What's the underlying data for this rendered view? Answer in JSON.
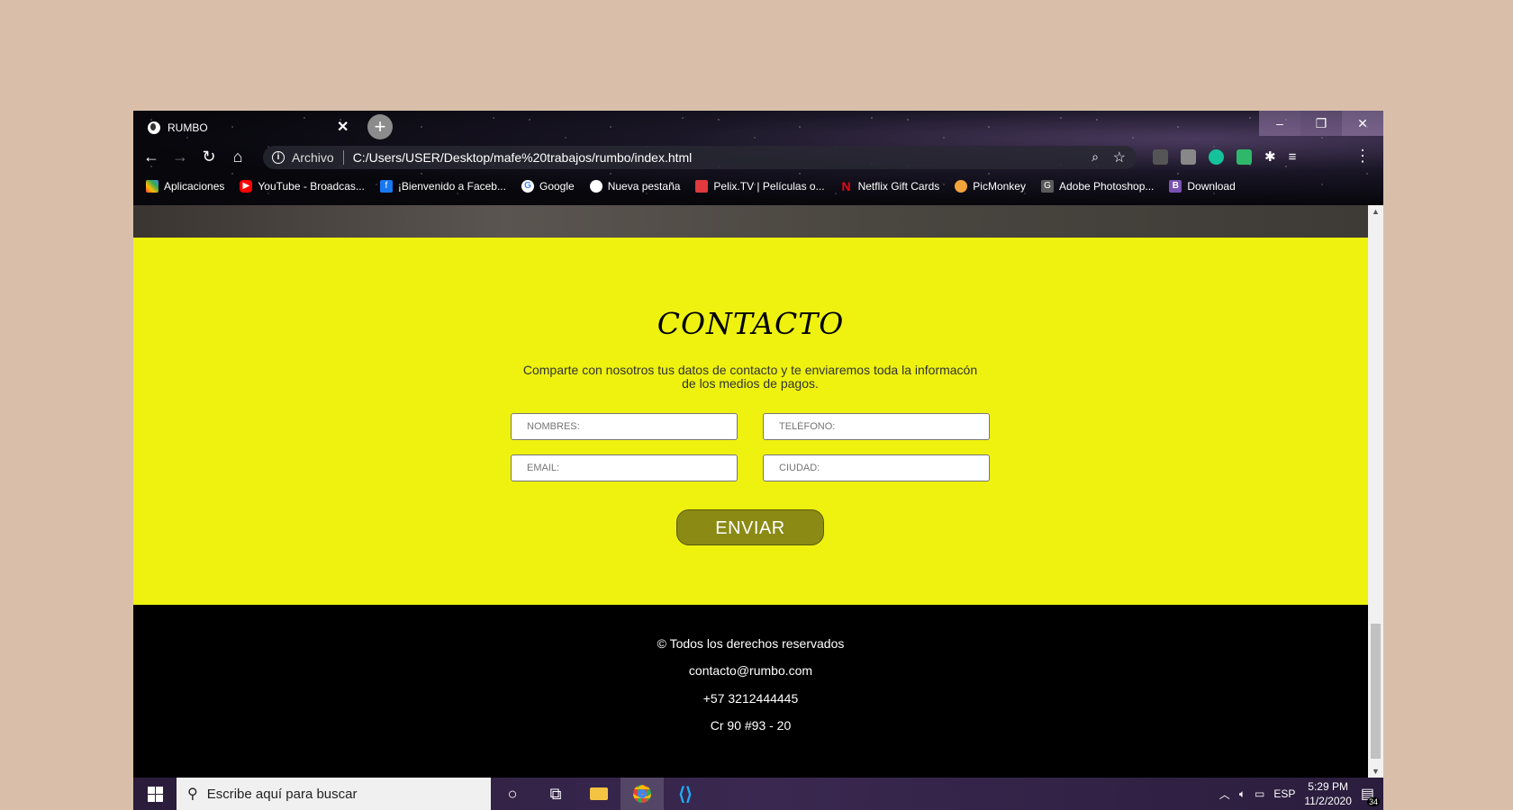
{
  "browser": {
    "tab_title": "RUMBO",
    "tab_close": "✕",
    "new_tab": "+",
    "security_label": "Archivo",
    "url": "C:/Users/USER/Desktop/mafe%20trabajos/rumbo/index.html",
    "window_controls": {
      "minimize": "–",
      "maximize": "❐",
      "close": "✕"
    }
  },
  "bookmarks": [
    {
      "label": "Aplicaciones",
      "icon": "apps-grid-icon",
      "color": "#ea4335"
    },
    {
      "label": "YouTube - Broadcas...",
      "icon": "youtube-icon",
      "color": "#ff0000"
    },
    {
      "label": "¡Bienvenido a Faceb...",
      "icon": "facebook-icon",
      "color": "#1877f2"
    },
    {
      "label": "Google",
      "icon": "google-icon",
      "color": "#ffffff"
    },
    {
      "label": "Nueva pestaña",
      "icon": "globe-icon",
      "color": "#ffffff"
    },
    {
      "label": "Pelix.TV | Películas o...",
      "icon": "pelix-icon",
      "color": "#e0393e"
    },
    {
      "label": "Netflix Gift Cards",
      "icon": "netflix-icon",
      "color": "#e50914"
    },
    {
      "label": "PicMonkey",
      "icon": "picmonkey-icon",
      "color": "#f2a33a"
    },
    {
      "label": "Adobe Photoshop...",
      "icon": "photoshop-icon",
      "color": "#5a5a5a"
    },
    {
      "label": "Download",
      "icon": "bootstrap-icon",
      "color": "#7952b3"
    }
  ],
  "contact": {
    "title": "CONTACTO",
    "description": "Comparte con nosotros tus datos de contacto y te enviaremos toda la informacón de los medios de pagos.",
    "fields": {
      "names": "NOMBRES:",
      "phone": "TELÉFONO:",
      "email": "EMAIL:",
      "city": "CIUDAD:"
    },
    "submit": "ENVIAR",
    "background": "#eef20e",
    "button_color": "#8a8a15"
  },
  "footer": {
    "rights": "© Todos los derechos reservados",
    "email": "contacto@rumbo.com",
    "phone": "+57 3212444445",
    "address": "Cr 90 #93 - 20"
  },
  "taskbar": {
    "search_placeholder": "Escribe aquí para buscar",
    "language": "ESP",
    "time": "5:29 PM",
    "date": "11/2/2020",
    "notifications": "34"
  }
}
